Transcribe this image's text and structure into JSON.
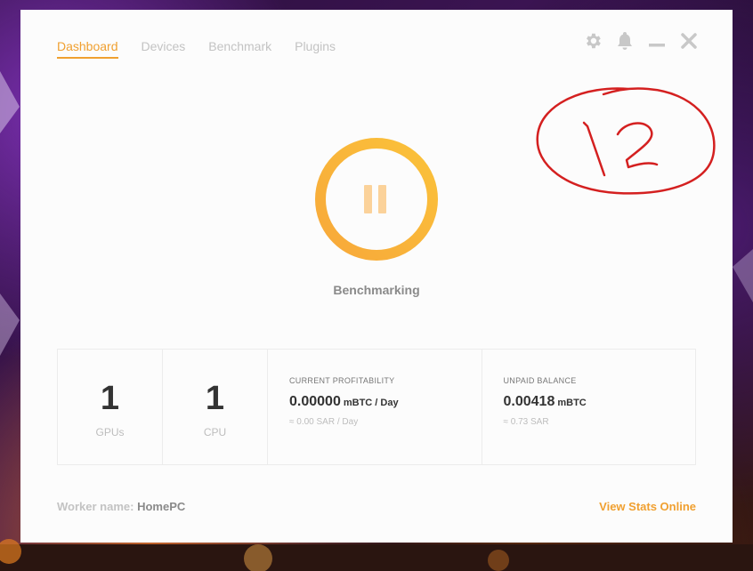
{
  "nav": {
    "tabs": [
      {
        "label": "Dashboard",
        "active": true
      },
      {
        "label": "Devices",
        "active": false
      },
      {
        "label": "Benchmark",
        "active": false
      },
      {
        "label": "Plugins",
        "active": false
      }
    ]
  },
  "window_controls": [
    "gear-icon",
    "bell-icon",
    "minimize-icon",
    "close-icon"
  ],
  "status": {
    "label": "Benchmarking",
    "icon": "pause-icon"
  },
  "stats": {
    "gpus": {
      "count": "1",
      "label": "GPUs"
    },
    "cpu": {
      "count": "1",
      "label": "CPU"
    },
    "profitability": {
      "title": "CURRENT PROFITABILITY",
      "value": "0.00000",
      "unit": "mBTC / Day",
      "fiat": "≈ 0.00 SAR / Day"
    },
    "balance": {
      "title": "UNPAID BALANCE",
      "value": "0.00418",
      "unit": "mBTC",
      "fiat": "≈ 0.73 SAR"
    }
  },
  "footer": {
    "worker_label": "Worker name:",
    "worker_name": "HomePC",
    "view_stats": "View Stats Online"
  },
  "annotation": {
    "text": "12"
  },
  "colors": {
    "accent": "#f0a030",
    "ring_start": "#f7a83a",
    "ring_end": "#fbc23a",
    "annotation": "#d42020"
  }
}
